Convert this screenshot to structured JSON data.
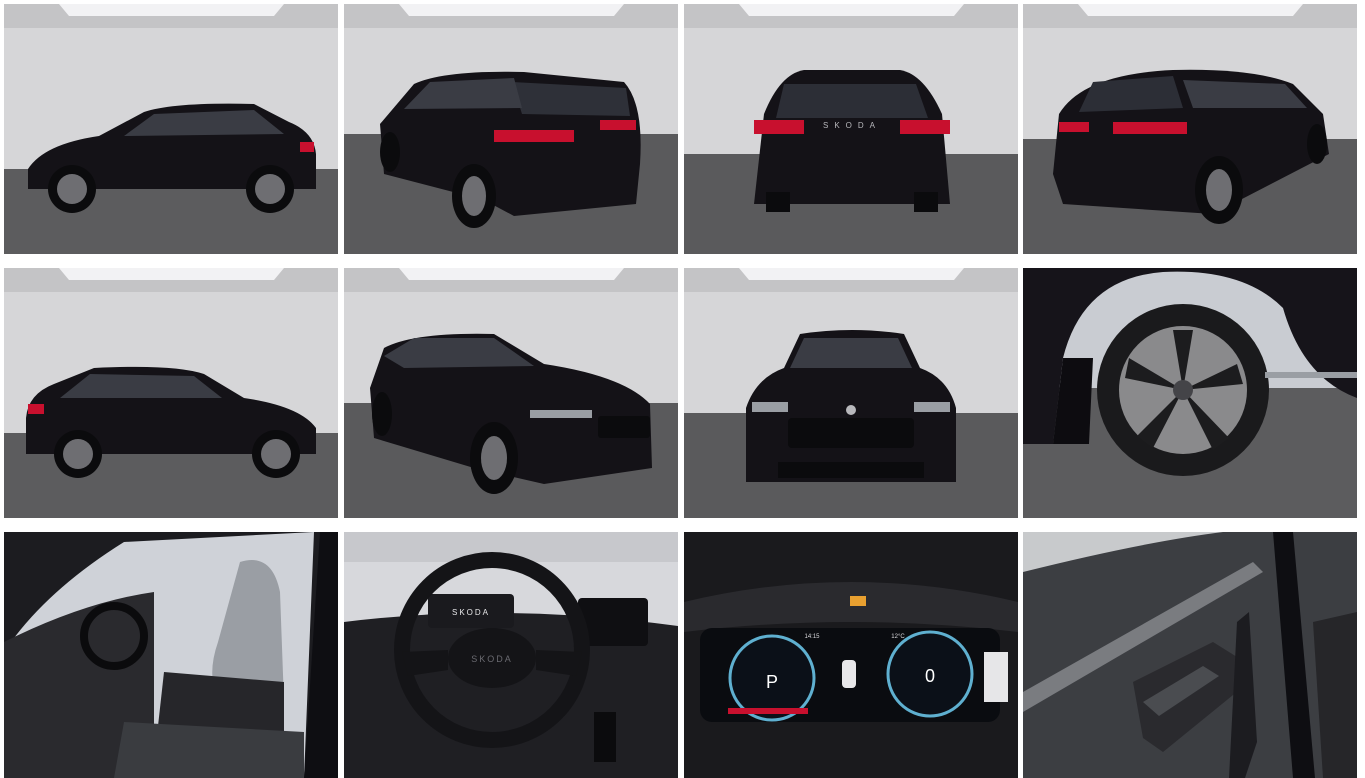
{
  "gallery": {
    "brand_text": "SKODA",
    "badge_text": "SKODA",
    "cluster": {
      "gear": "P",
      "speed": "0",
      "time": "14:15",
      "outside_temp": "12°C"
    }
  },
  "colors": {
    "car_paint": "#141217",
    "studio_wall": "#d8d8da",
    "studio_floor": "#5a5a5c",
    "tail_light": "#c8102e",
    "interior_dark": "#1c1c20",
    "interior_light": "#9a9ea4"
  },
  "tiles": [
    {
      "icon": "car-side-left-icon"
    },
    {
      "icon": "car-rear-quarter-left-icon"
    },
    {
      "icon": "car-rear-icon"
    },
    {
      "icon": "car-rear-quarter-right-icon"
    },
    {
      "icon": "car-side-right-icon"
    },
    {
      "icon": "car-front-quarter-icon"
    },
    {
      "icon": "car-front-icon"
    },
    {
      "icon": "wheel-rim-icon"
    },
    {
      "icon": "interior-seats-icon"
    },
    {
      "icon": "steering-wheel-icon"
    },
    {
      "icon": "digital-cockpit-icon"
    },
    {
      "icon": "door-panel-icon"
    }
  ]
}
